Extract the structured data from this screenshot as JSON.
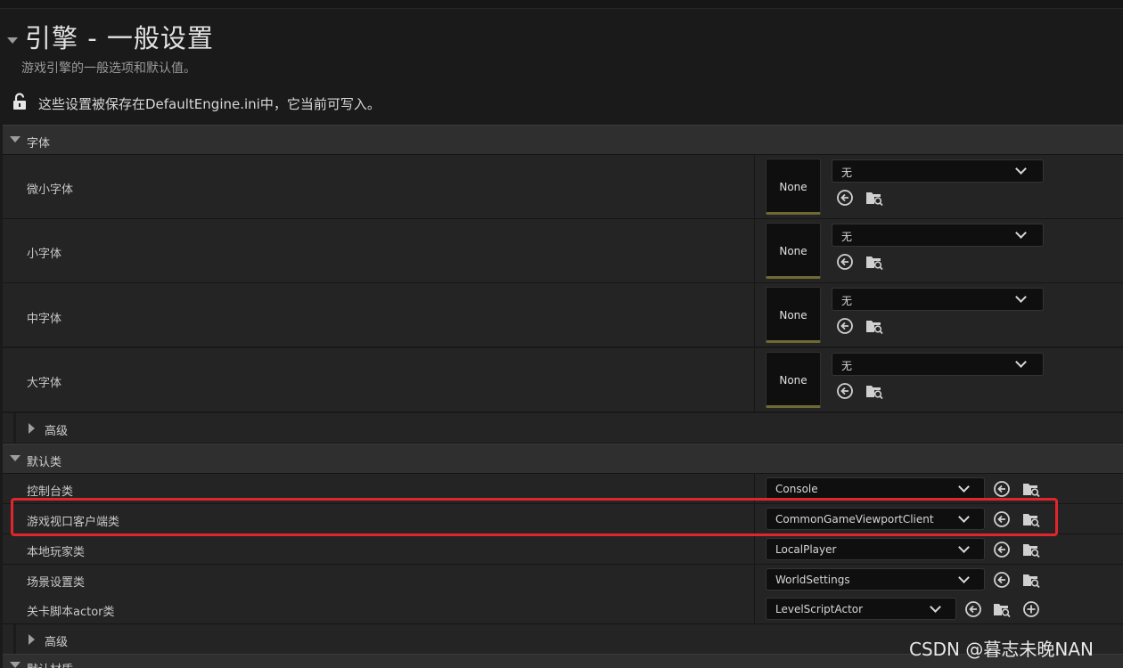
{
  "header": {
    "title": "引擎 - 一般设置",
    "subtitle": "游戏引擎的一般选项和默认值。",
    "save_notice": "这些设置被保存在DefaultEngine.ini中，它当前可写入。"
  },
  "fonts_section": {
    "label": "字体",
    "rows": [
      {
        "label": "微小字体",
        "thumb": "None",
        "value": "无"
      },
      {
        "label": "小字体",
        "thumb": "None",
        "value": "无"
      },
      {
        "label": "中字体",
        "thumb": "None",
        "value": "无"
      },
      {
        "label": "大字体",
        "thumb": "None",
        "value": "无"
      }
    ],
    "advanced_label": "高级"
  },
  "default_classes_section": {
    "label": "默认类",
    "rows": [
      {
        "label": "控制台类",
        "value": "Console"
      },
      {
        "label": "游戏视口客户端类",
        "value": "CommonGameViewportClient"
      },
      {
        "label": "本地玩家类",
        "value": "LocalPlayer"
      },
      {
        "label": "场景设置类",
        "value": "WorldSettings"
      },
      {
        "label": "关卡脚本actor类",
        "value": "LevelScriptActor"
      }
    ],
    "advanced_label": "高级"
  },
  "next_section": {
    "label": "默认材质"
  },
  "watermark": "CSDN @暮志未晚NAN",
  "colors": {
    "highlight": "#e0262c",
    "thumb_underline": "#6f6a34",
    "background": "#1a1a1a",
    "row": "#242424",
    "category": "#2f2f2f"
  },
  "icons": [
    "lock-open-icon",
    "reset-arrow-icon",
    "browse-folder-icon",
    "add-circle-icon",
    "chevron-down-icon"
  ]
}
